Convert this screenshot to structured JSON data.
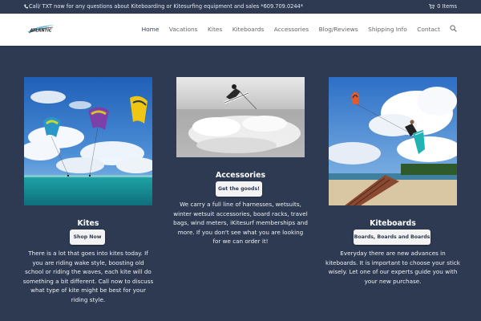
{
  "topbar": {
    "phone_text": "Call/ TXT now for any questions about Kiteboarding or Kitesurfing equipment and sales *609.709.0244*",
    "cart_text": "0 Items"
  },
  "header": {
    "logo_alt": "Atlantic",
    "nav": [
      {
        "label": "Home",
        "active": true
      },
      {
        "label": "Vacations",
        "active": false
      },
      {
        "label": "Kites",
        "active": false
      },
      {
        "label": "Kiteboards",
        "active": false
      },
      {
        "label": "Accessories",
        "active": false
      },
      {
        "label": "Blog/Reviews",
        "active": false
      },
      {
        "label": "Shipping Info",
        "active": false
      },
      {
        "label": "Contact",
        "active": false
      }
    ]
  },
  "columns": [
    {
      "title": "Kites",
      "button": "Shop Now",
      "description": "There is a lot that goes into kites today. If you are riding wake style, boosting old school or riding the waves, each kite will do something a bit different. Call now to discuss what type of kite might be best for your riding style."
    },
    {
      "title": "Accessories",
      "button": "Get the goods!",
      "description": "We carry a full line of harnesses, wetsuits, winter wetsuit accessories, board racks, travel bags, wind meters, iKitesurf memberships and more. If you don't see what you are looking for we can order it!"
    },
    {
      "title": "Kiteboards",
      "button": "Boards, Boards and Boards",
      "description": "Everyday there are new advances in kiteboards. It is important to choose your stick wisely. Let one of our experts guide you with your new purchase."
    }
  ],
  "colors": {
    "background": "#2d3a52",
    "header_bg": "#ffffff",
    "nav_active": "#2d3a52",
    "button_bg": "#f3f3f3"
  }
}
